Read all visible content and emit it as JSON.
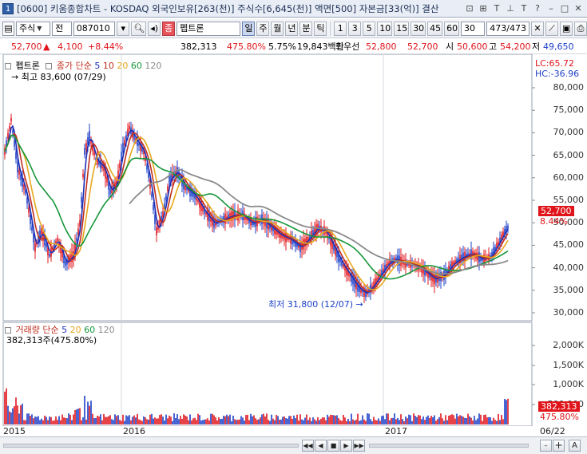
{
  "window": {
    "index": "1",
    "title": "[0600] 키움종합차트 - KOSDAQ 외국인보유[263(천)] 주식수[6,645(천)] 액면[500] 자본금[33(억)] 결산"
  },
  "toolbar": {
    "type_select": "주식",
    "period_label": "전",
    "code": "087010",
    "name_badge": "종",
    "stock_name": "펩트론",
    "tab_intraday": "일",
    "tabs": [
      "주",
      "월",
      "년",
      "분",
      "틱"
    ],
    "intervals": [
      "1",
      "3",
      "5",
      "10",
      "15",
      "30",
      "45",
      "60"
    ],
    "interval_value": "30",
    "page_counter": "473/473"
  },
  "quote": {
    "price": "52,700",
    "change": "4,100",
    "change_pct": "+8.44%",
    "volume": "382,313",
    "volume_pct": "475.80%",
    "turnover": "5.75%",
    "amount": "19,843백만",
    "best_bid_label": "최우선",
    "best_bid": "52,800",
    "best_ask": "52,700",
    "open_label": "시",
    "open": "50,600",
    "high_label": "고",
    "high": "54,200",
    "low_label": "저",
    "low": "49,650"
  },
  "price_panel": {
    "legend_name": "펩트론",
    "legend_ma_label": "종가 단순",
    "ma_periods": [
      "5",
      "10",
      "20",
      "60",
      "120"
    ],
    "ma_colors": [
      "#1d2db5",
      "#c03020",
      "#e6a81d",
      "#16963a",
      "#8a8a8a"
    ],
    "high_mark": "최고 83,600 (07/29)",
    "low_mark": "최저 31,800 (12/07)",
    "lc": "LC:65.72",
    "hc": "HC:-36.96",
    "current_price_tag": "52,700",
    "current_pct_tag": "8.44%",
    "y_ticks": [
      "80,000",
      "75,000",
      "70,000",
      "65,000",
      "60,000",
      "55,000",
      "50,000",
      "45,000",
      "40,000",
      "35,000",
      "30,000"
    ]
  },
  "volume_panel": {
    "legend_name": "거래량",
    "legend_ma_label": "단순",
    "ma_periods": [
      "5",
      "20",
      "60",
      "120"
    ],
    "summary": "382,313주(475.80%)",
    "y_ticks": [
      "2,000K",
      "1,500K",
      "1,000K",
      "500,000"
    ],
    "current_tag": "382,313",
    "current_pct_tag": "475.80%"
  },
  "x_axis": {
    "labels": [
      "2015",
      "2016",
      "2017",
      "06/22"
    ]
  },
  "colors": {
    "up": "#e0151b",
    "down": "#1b3fc8",
    "ma5": "#1d2db5",
    "ma10": "#c03020",
    "ma20": "#e6a81d",
    "ma60": "#16963a",
    "ma120": "#8a8a8a"
  }
}
